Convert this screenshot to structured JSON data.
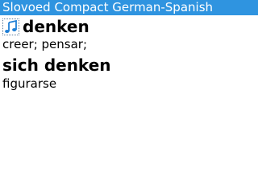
{
  "app": {
    "title": "Slovoed Compact German-Spanish"
  },
  "entry": {
    "sound_icon": "music-note-icon",
    "headword": "denken",
    "translation": "creer; pensar;",
    "phrase": "sich denken",
    "phrase_translation": "figurarse"
  },
  "colors": {
    "titlebar_bg": "#2f94e0",
    "titlebar_text": "#ffffff",
    "icon_blue": "#1f7fd6"
  }
}
